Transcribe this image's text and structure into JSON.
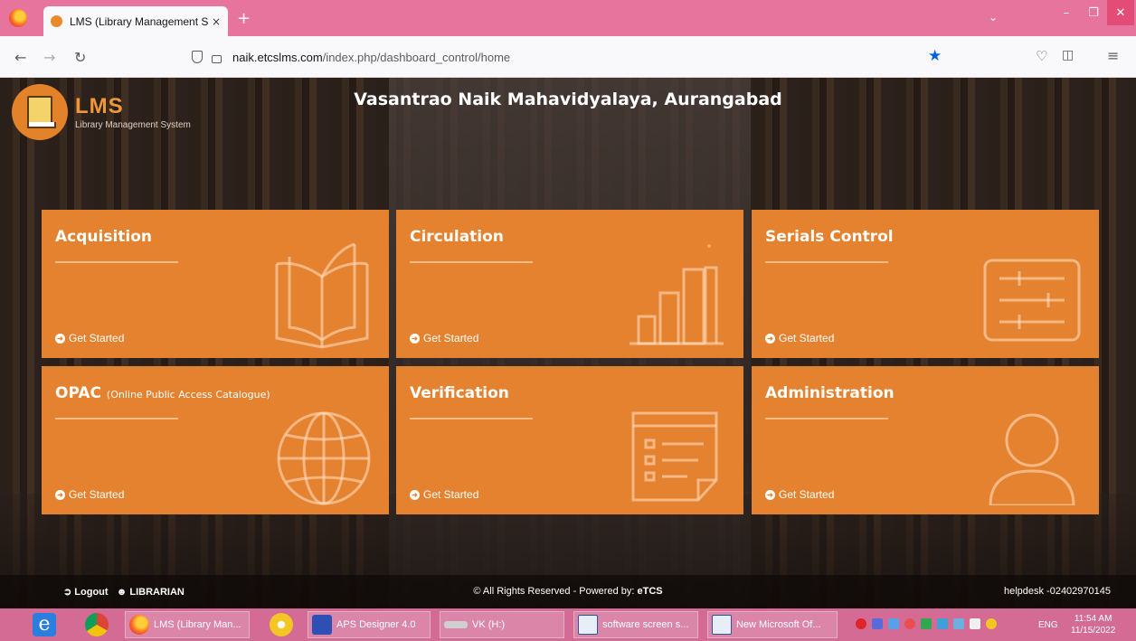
{
  "browser": {
    "tab_title": "LMS (Library Management Syst…",
    "tab_close": "×",
    "new_tab": "+",
    "url_domain": "naik.etcslms.com",
    "url_path": "/index.php/dashboard_control/home"
  },
  "header": {
    "logo_text": "LMS",
    "logo_subtitle": "Library Management System",
    "college_name": "Vasantrao Naik Mahavidyalaya, Aurangabad"
  },
  "tiles": [
    {
      "title": "Acquisition",
      "subtitle": "",
      "cta": "Get Started",
      "icon": "open-book-icon"
    },
    {
      "title": "Circulation",
      "subtitle": "",
      "cta": "Get Started",
      "icon": "bar-chart-icon"
    },
    {
      "title": "Serials Control",
      "subtitle": "",
      "cta": "Get Started",
      "icon": "sliders-icon"
    },
    {
      "title": "OPAC",
      "subtitle": "(Online Public Access Catalogue)",
      "cta": "Get Started",
      "icon": "globe-icon"
    },
    {
      "title": "Verification",
      "subtitle": "",
      "cta": "Get Started",
      "icon": "checklist-icon"
    },
    {
      "title": "Administration",
      "subtitle": "",
      "cta": "Get Started",
      "icon": "user-icon"
    }
  ],
  "footer": {
    "logout": "Logout",
    "role": "LIBRARIAN",
    "copyright": "© All Rights Reserved - Powered by:",
    "powered_brand": "eTCS",
    "helpdesk": "helpdesk -02402970145"
  },
  "taskbar": {
    "items": [
      "LMS (Library Man...",
      "APS Designer 4.0",
      "VK (H:)",
      "software screen s...",
      "New Microsoft Of..."
    ],
    "language": "ENG",
    "time": "11:54 AM",
    "date": "11/15/2022"
  },
  "colors": {
    "tile": "#e5822f",
    "tabbar": "#e6749c",
    "taskbar": "#d46b95"
  }
}
